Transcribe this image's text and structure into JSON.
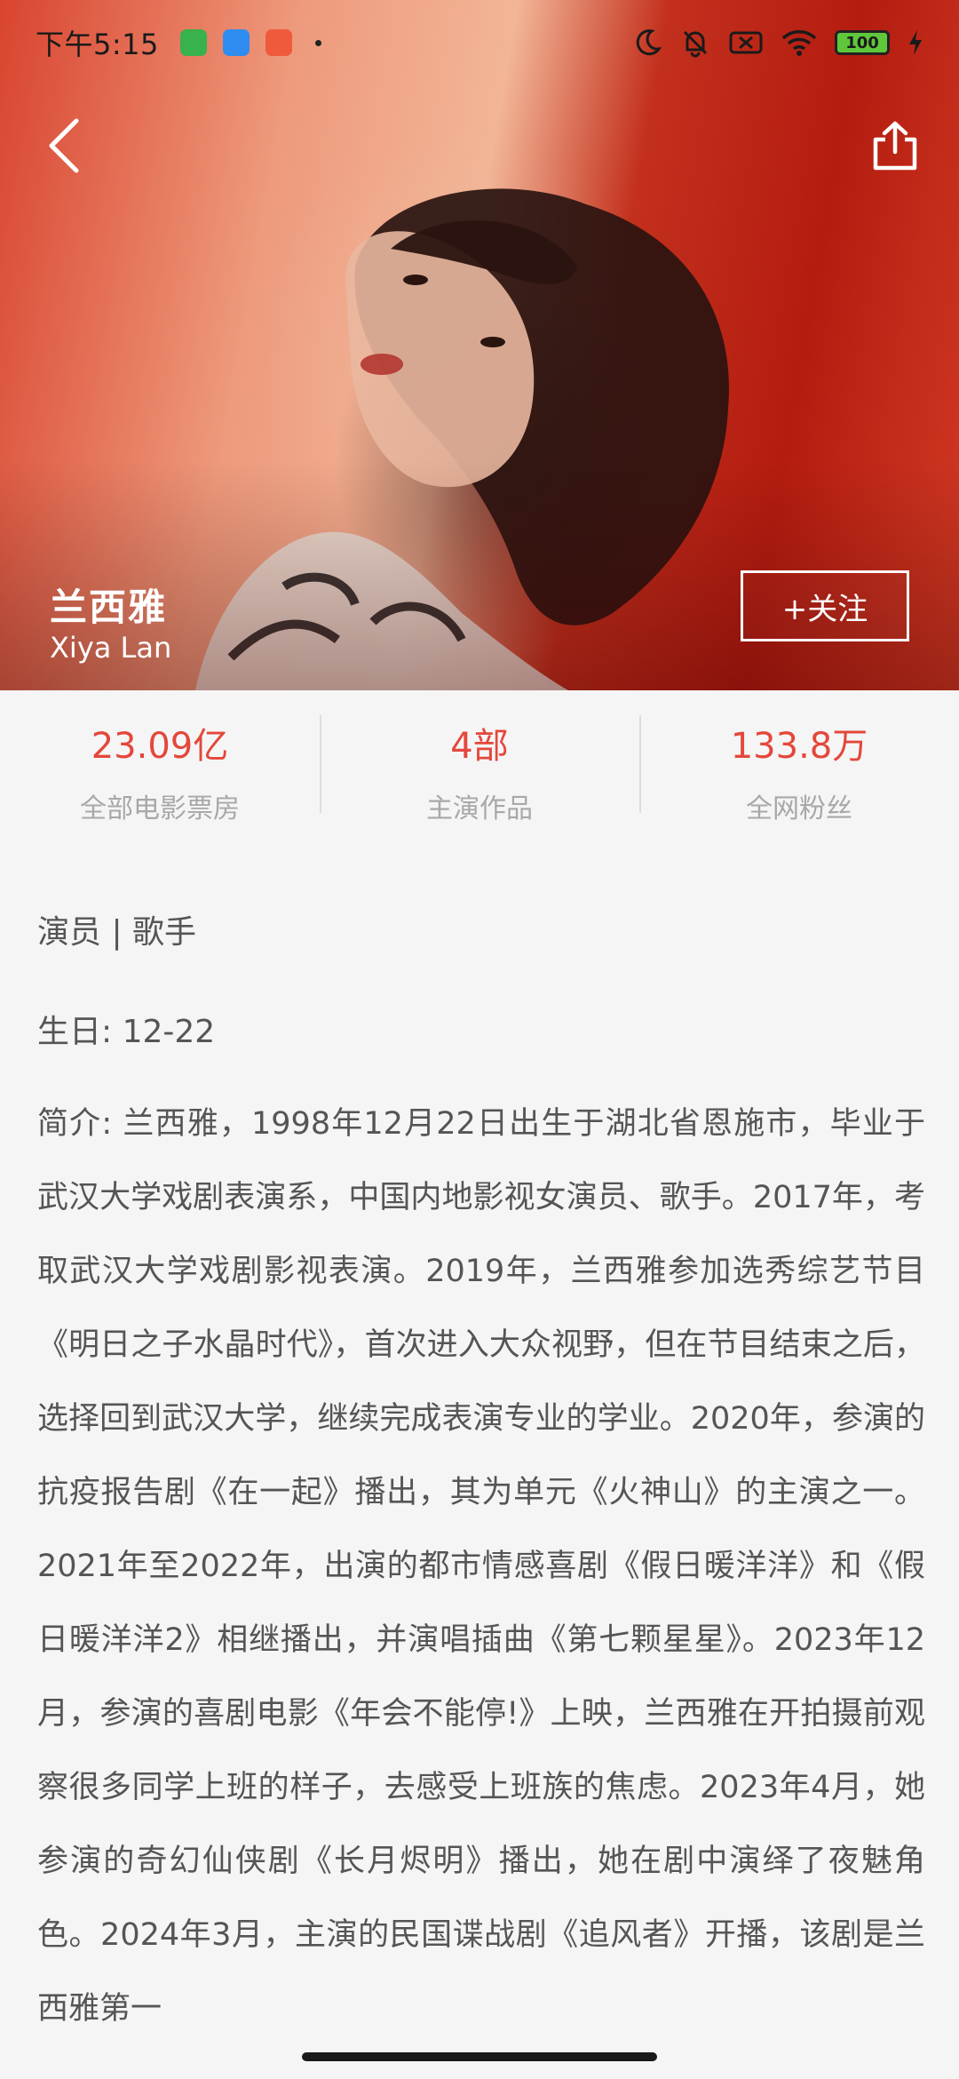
{
  "status_bar": {
    "time": "下午5:15",
    "battery": "100"
  },
  "actor": {
    "name_cn": "兰西雅",
    "name_en": "Xiya Lan"
  },
  "follow_label": "+关注",
  "stats": [
    {
      "value": "23.09亿",
      "label": "全部电影票房"
    },
    {
      "value": "4部",
      "label": "主演作品"
    },
    {
      "value": "133.8万",
      "label": "全网粉丝"
    }
  ],
  "bio": {
    "roles": "演员 | 歌手",
    "birthday": "生日: 12-22",
    "intro": "简介: 兰西雅，1998年12月22日出生于湖北省恩施市，毕业于武汉大学戏剧表演系，中国内地影视女演员、歌手。2017年，考取武汉大学戏剧影视表演。2019年，兰西雅参加选秀综艺节目《明日之子水晶时代》，首次进入大众视野，但在节目结束之后，选择回到武汉大学，继续完成表演专业的学业。2020年，参演的抗疫报告剧《在一起》播出，其为单元《火神山》的主演之一。2021年至2022年，出演的都市情感喜剧《假日暖洋洋》和《假日暖洋洋2》相继播出，并演唱插曲《第七颗星星》。2023年12月，参演的喜剧电影《年会不能停!》上映，兰西雅在开拍摄前观察很多同学上班的样子，去感受上班族的焦虑。2023年4月，她参演的奇幻仙侠剧《长月烬明》播出，她在剧中演绎了夜魅角色。2024年3月，主演的民国谍战剧《追风者》开播，该剧是兰西雅第一"
  },
  "colors": {
    "accent": "#e4473b",
    "label_gray": "#a8a8a8",
    "text": "#555555",
    "background": "#f5f5f5"
  },
  "icons": {
    "back": "back-arrow-icon",
    "share": "share-icon"
  }
}
